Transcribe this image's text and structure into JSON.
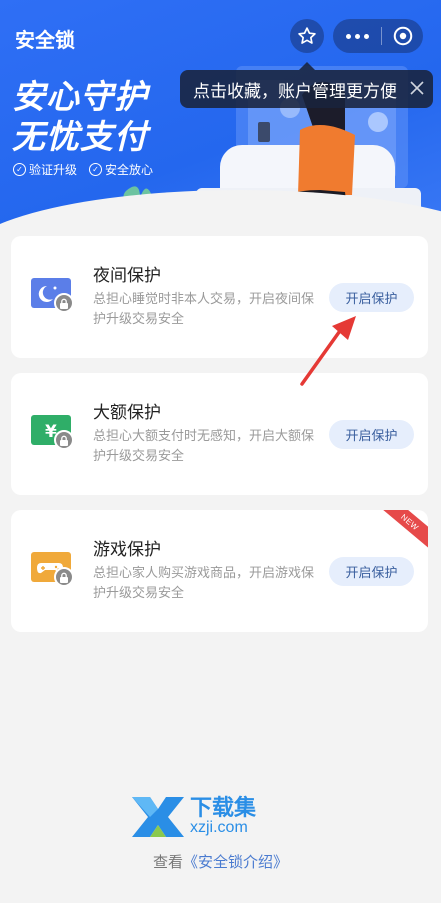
{
  "header": {
    "title": "安全锁",
    "slogan_line1": "安心守护",
    "slogan_line2": "无忧支付",
    "badges": [
      "验证升级",
      "安全放心"
    ]
  },
  "tooltip": {
    "text": "点击收藏，账户管理更方便"
  },
  "cards": [
    {
      "title": "夜间保护",
      "desc": "总担心睡觉时非本人交易，开启夜间保护升级交易安全",
      "button": "开启保护",
      "icon": "moon-star-icon",
      "icon_color": "#5b7ee8",
      "is_new": false
    },
    {
      "title": "大额保护",
      "desc": "总担心大额支付时无感知，开启大额保护升级交易安全",
      "button": "开启保护",
      "icon": "yuan-icon",
      "icon_color": "#2fae68",
      "is_new": false
    },
    {
      "title": "游戏保护",
      "desc": "总担心家人购买游戏商品，开启游戏保护升级交易安全",
      "button": "开启保护",
      "icon": "gamepad-icon",
      "icon_color": "#f0a93a",
      "is_new": true,
      "new_label": "NEW"
    }
  ],
  "footer": {
    "watermark_cn": "下载集",
    "watermark_en": "xzji.com",
    "link_prefix": "查看",
    "link_text": "《安全锁介绍》"
  },
  "colors": {
    "primary": "#2467ee",
    "button_bg": "#e6eefc",
    "button_text": "#3a5f9e",
    "annotation_arrow": "#e53935"
  }
}
